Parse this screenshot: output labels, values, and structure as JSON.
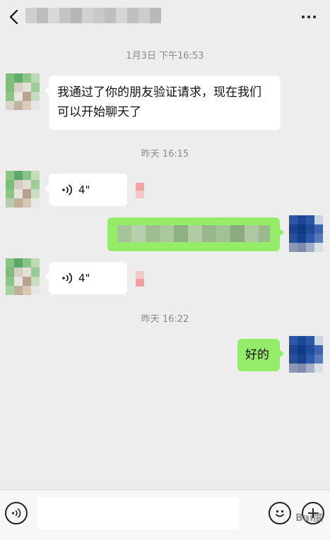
{
  "header": {
    "back_icon": "chevron-left-icon",
    "more_icon": "more-dots-icon"
  },
  "messages": {
    "ts1": "1月3日 下午16:53",
    "msg1": "我通过了你的朋友验证请求，现在我们可以开始聊天了",
    "ts2": "昨天 16:15",
    "voice1_duration": "4\"",
    "voice2_duration": "4\"",
    "ts3": "昨天 16:22",
    "reply": "好的"
  },
  "footer": {
    "voice_icon": "voice-icon",
    "emoji_icon": "emoji-icon",
    "plus_icon": "plus-icon",
    "watermark": "Bai度"
  },
  "colors": {
    "background": "#ededed",
    "sent_bubble": "#95ec69",
    "received_bubble": "#ffffff"
  }
}
